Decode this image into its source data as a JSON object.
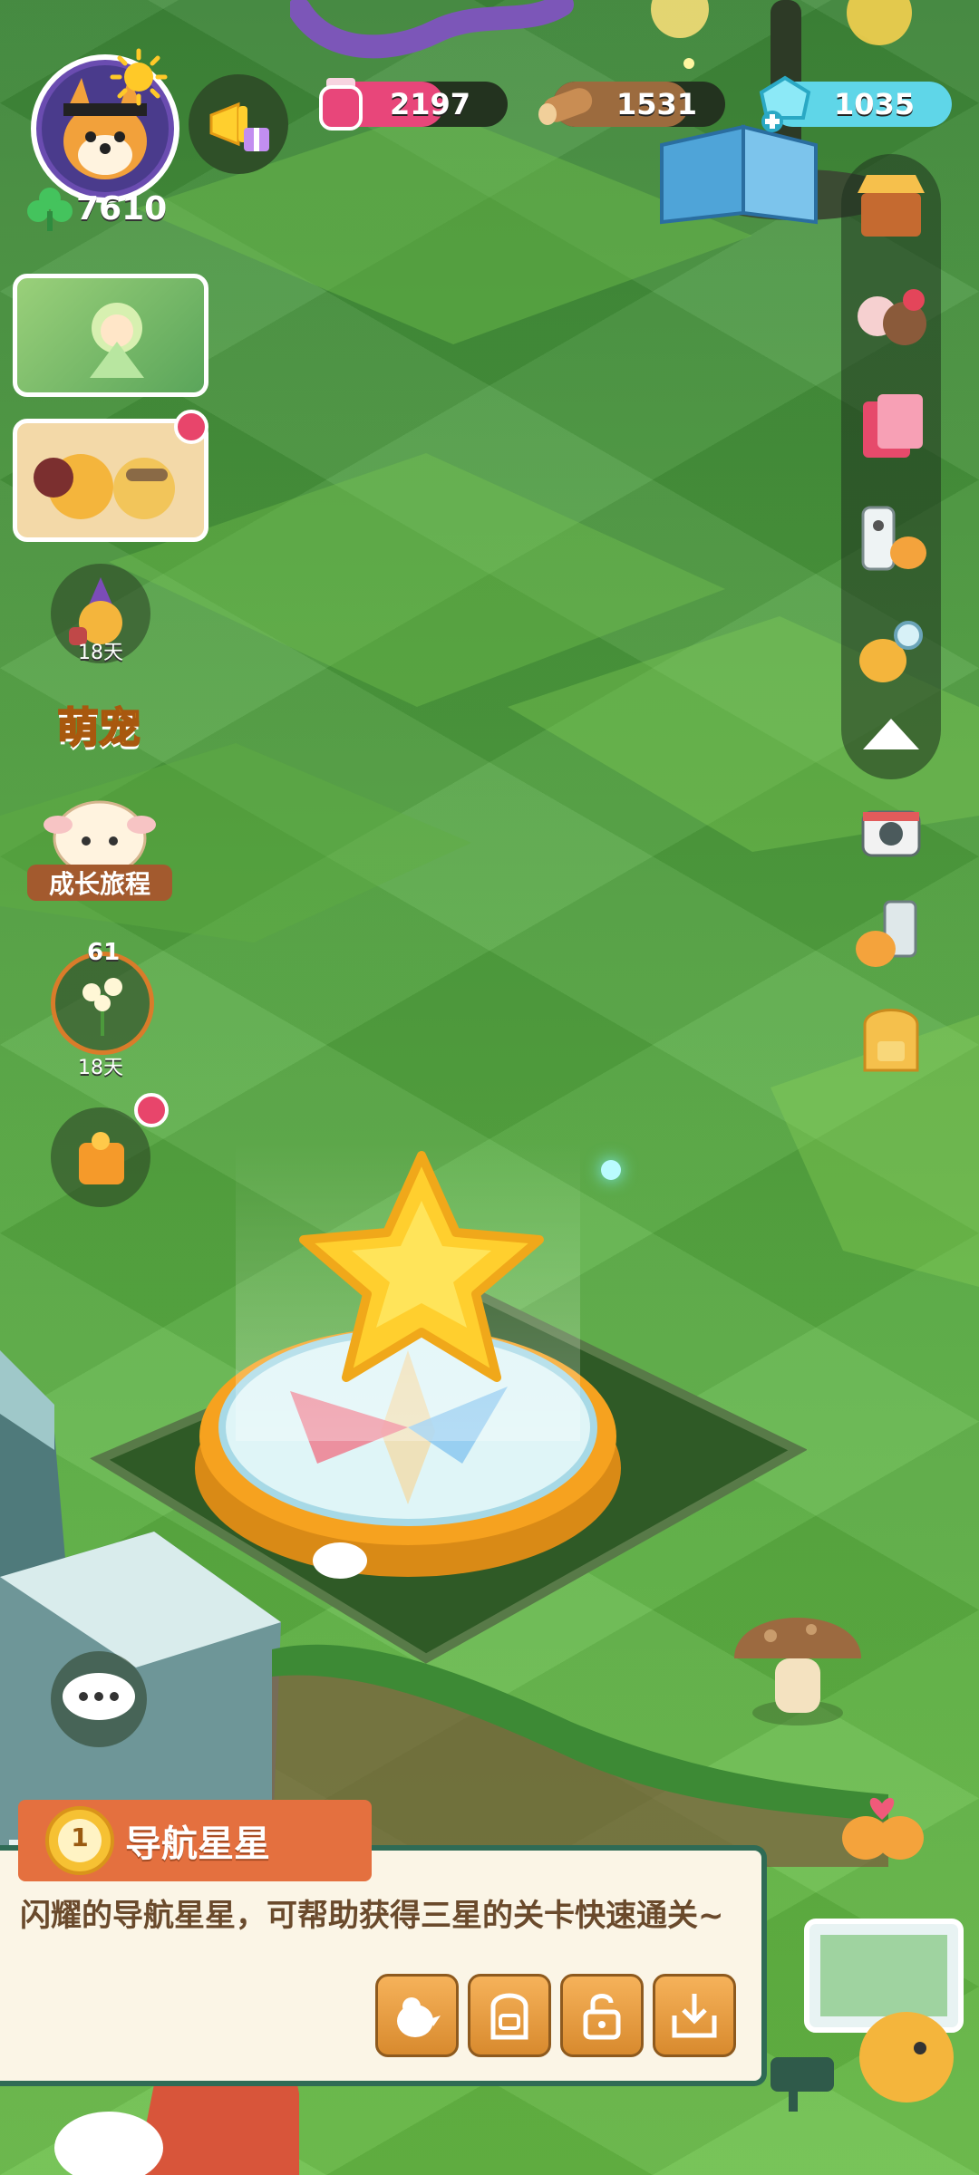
{
  "player": {
    "clover_count": "7610",
    "avatar_icon": "shiba-dog-avatar",
    "weather_icon": "sun-icon"
  },
  "resources": {
    "ink": {
      "value": "2197",
      "icon": "ink-bottle-icon",
      "color": "#e8467a"
    },
    "wood": {
      "value": "1531",
      "icon": "wood-log-icon",
      "color": "#b07a45"
    },
    "gem": {
      "value": "1035",
      "icon": "gem-plus-icon",
      "color": "#5fd6e8"
    }
  },
  "left_events": {
    "event_badge_days": "18天",
    "flower_event_level": "61",
    "flower_event_days": "18天",
    "pet_label": "萌宠",
    "growth_label": "成长旅程"
  },
  "item_panel": {
    "level": "1",
    "title": "导航星星",
    "description": "闪耀的导航星星，可帮助获得三星的关卡快速通关~"
  },
  "colors": {
    "grass": "#5aaf43",
    "panel_bg": "#fbf5e6",
    "panel_border": "#2f6b55",
    "title_banner": "#e4703f",
    "star_yellow": "#ffd13a",
    "compass_base": "#f6a21f"
  }
}
